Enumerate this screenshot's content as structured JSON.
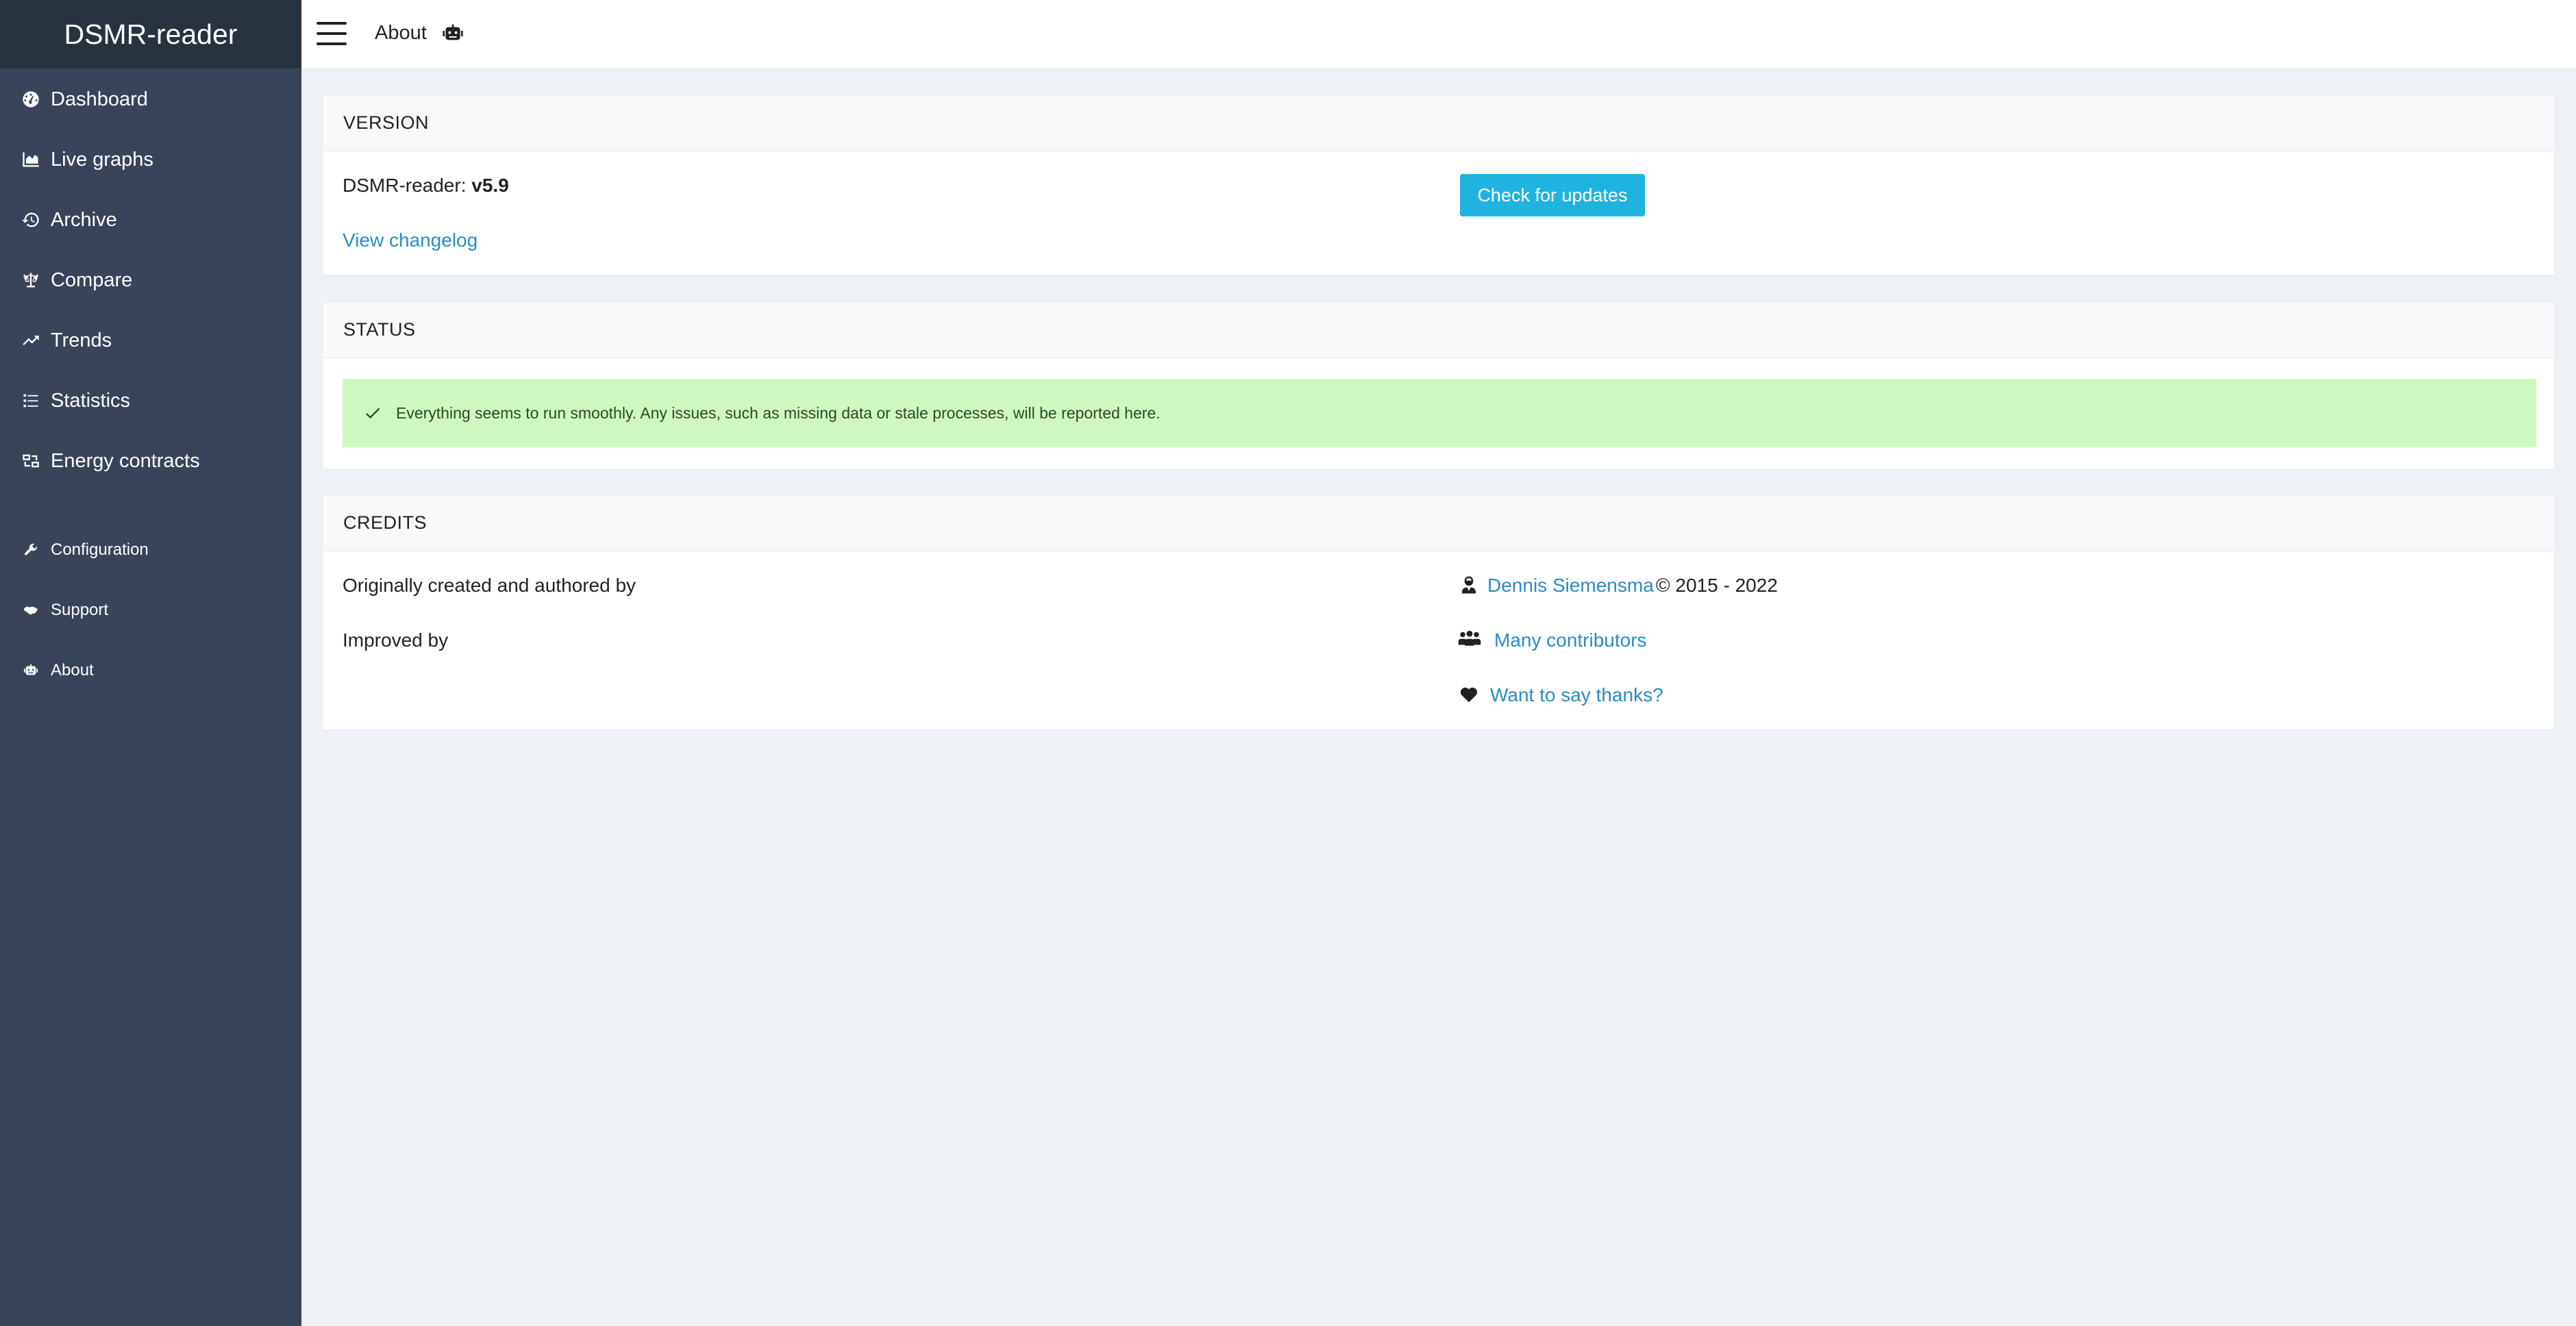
{
  "app": {
    "brand": "DSMR-reader"
  },
  "sidebar": {
    "items": [
      {
        "label": "Dashboard",
        "icon": "dashboard-icon"
      },
      {
        "label": "Live graphs",
        "icon": "chart-area-icon"
      },
      {
        "label": "Archive",
        "icon": "history-icon"
      },
      {
        "label": "Compare",
        "icon": "balance-scale-icon"
      },
      {
        "label": "Trends",
        "icon": "trend-up-icon"
      },
      {
        "label": "Statistics",
        "icon": "list-icon"
      },
      {
        "label": "Energy contracts",
        "icon": "contracts-icon"
      },
      {
        "label": "Configuration",
        "icon": "wrench-icon"
      },
      {
        "label": "Support",
        "icon": "handshake-icon"
      },
      {
        "label": "About",
        "icon": "robot-icon"
      }
    ]
  },
  "topbar": {
    "title": "About",
    "title_icon": "robot-icon"
  },
  "version": {
    "header": "VERSION",
    "label": "DSMR-reader: ",
    "value": "v5.9",
    "changelog_link": "View changelog",
    "update_button": "Check for updates"
  },
  "status": {
    "header": "STATUS",
    "message": "Everything seems to run smoothly. Any issues, such as missing data or stale processes, will be reported here."
  },
  "credits": {
    "header": "CREDITS",
    "created_label": "Originally created and authored by",
    "author_link": "Dennis Siemensma",
    "copyright": "© 2015 - 2022",
    "improved_label": "Improved by",
    "contributors_link": "Many contributors",
    "thanks_link": "Want to say thanks?"
  },
  "colors": {
    "sidebar_bg": "#3a4459",
    "brand_bg": "#29333f",
    "accent": "#1fb3e0",
    "link": "#2a8cc4",
    "success_bg": "#cff8bf"
  }
}
